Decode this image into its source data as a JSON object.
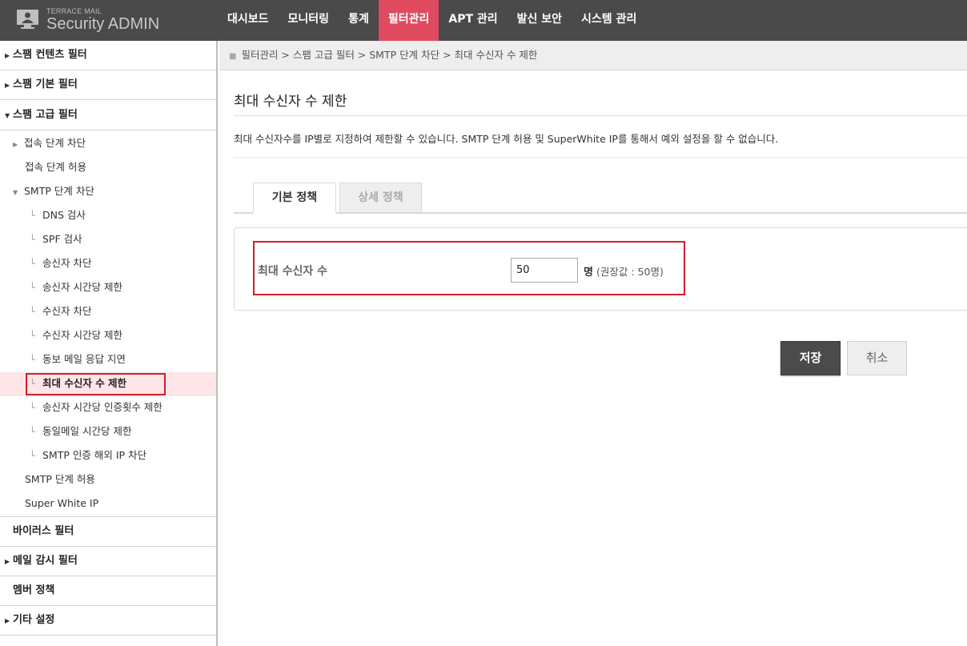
{
  "brand": {
    "small": "TERRACE MAIL",
    "big": "Security ADMIN"
  },
  "top_nav": [
    {
      "label": "대시보드",
      "active": false
    },
    {
      "label": "모니터링",
      "active": false
    },
    {
      "label": "통계",
      "active": false
    },
    {
      "label": "필터관리",
      "active": true
    },
    {
      "label": "APT 관리",
      "active": false
    },
    {
      "label": "발신 보안",
      "active": false
    },
    {
      "label": "시스템 관리",
      "active": false
    }
  ],
  "sidebar": {
    "spam_content": "스팸 컨텐츠 필터",
    "spam_basic": "스팸 기본 필터",
    "spam_advanced": "스팸 고급 필터",
    "advanced_items": {
      "conn_block": "접속 단계 차단",
      "conn_allow": "접속 단계 허용",
      "smtp_block": "SMTP 단계 차단",
      "dns_check": "DNS 검사",
      "spf_check": "SPF 검사",
      "sender_block": "송신자 차단",
      "sender_rate": "송신자 시간당 제한",
      "recipient_block": "수신자 차단",
      "recipient_rate": "수신자 시간당 제한",
      "same_reply_delay": "동보 메일 응답 지연",
      "max_recipients": "최대 수신자 수 제한",
      "sender_auth_rate": "송신자 시간당 인증횟수 제한",
      "same_mail_rate": "동일메일 시간당 제한",
      "smtp_auth_foreign_ip": "SMTP 인증 해외 IP 차단",
      "smtp_allow": "SMTP 단계 허용",
      "super_white_ip": "Super White IP"
    },
    "virus": "바이러스 필터",
    "mail_audit": "메일 감시 필터",
    "member_policy": "멤버 정책",
    "other_settings": "기타 설정"
  },
  "breadcrumb": "필터관리 > 스팸 고급 필터 > SMTP 단계 차단 > 최대 수신자 수 제한",
  "page": {
    "title": "최대 수신자 수 제한",
    "description": "최대 수신자수를 IP별로 지정하여 제한할 수 있습니다. SMTP 단계 허용 및 SuperWhite IP를 통해서 예외 설정을 할 수 없습니다.",
    "tabs": [
      {
        "label": "기본 정책",
        "active": true
      },
      {
        "label": "상세 정책",
        "active": false
      }
    ],
    "field_label": "최대 수신자 수",
    "field_value": "50",
    "field_unit": "명",
    "field_hint": "(권장값 : 50명)",
    "save_label": "저장",
    "cancel_label": "취소"
  },
  "colors": {
    "topbar": "#4a4a4a",
    "accent": "#e04a5f",
    "highlight_border": "#d0202a",
    "selected_bg": "#fde5e8"
  }
}
